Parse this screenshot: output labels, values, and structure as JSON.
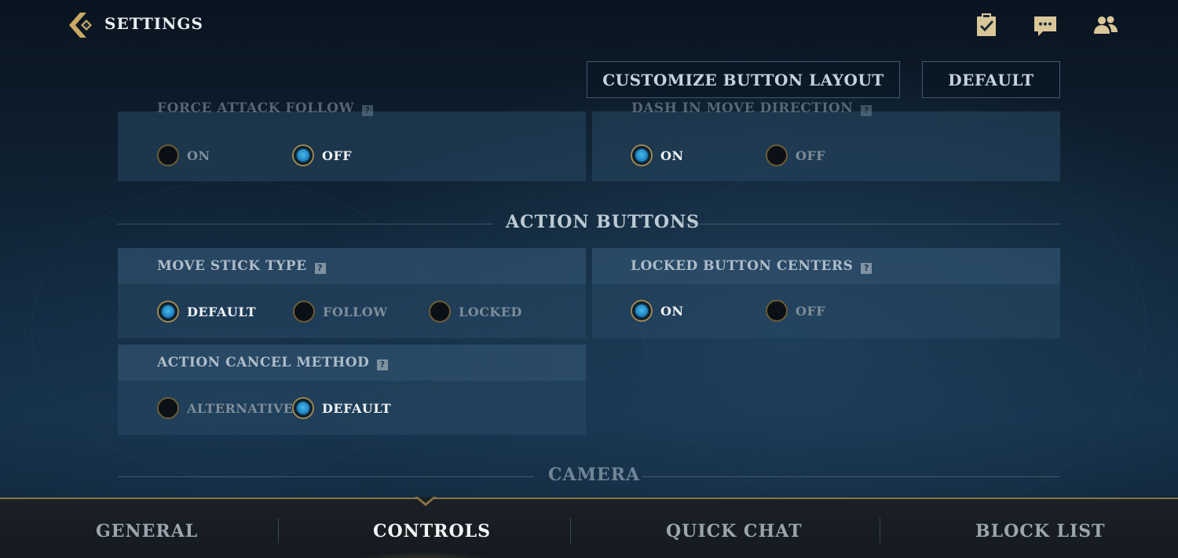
{
  "header": {
    "title": "SETTINGS",
    "icons": [
      "checklist-icon",
      "chat-icon",
      "friends-icon"
    ]
  },
  "actions": {
    "customize_label": "CUSTOMIZE BUTTON LAYOUT",
    "default_label": "DEFAULT"
  },
  "panels": {
    "force_attack_follow": {
      "title": "FORCE ATTACK FOLLOW",
      "options": [
        {
          "label": "ON",
          "selected": false
        },
        {
          "label": "OFF",
          "selected": true
        }
      ]
    },
    "dash_in_move_direction": {
      "title": "DASH IN MOVE DIRECTION",
      "options": [
        {
          "label": "ON",
          "selected": true
        },
        {
          "label": "OFF",
          "selected": false
        }
      ]
    },
    "move_stick_type": {
      "title": "MOVE STICK TYPE",
      "options": [
        {
          "label": "DEFAULT",
          "selected": true
        },
        {
          "label": "FOLLOW",
          "selected": false
        },
        {
          "label": "LOCKED",
          "selected": false
        }
      ]
    },
    "locked_button_centers": {
      "title": "LOCKED BUTTON CENTERS",
      "options": [
        {
          "label": "ON",
          "selected": true
        },
        {
          "label": "OFF",
          "selected": false
        }
      ]
    },
    "action_cancel_method": {
      "title": "ACTION CANCEL METHOD",
      "options": [
        {
          "label": "ALTERNATIVE",
          "selected": false
        },
        {
          "label": "DEFAULT",
          "selected": true
        }
      ]
    }
  },
  "sections": {
    "action_buttons": "ACTION BUTTONS",
    "camera": "CAMERA"
  },
  "help_glyph": "?",
  "tabs": [
    {
      "label": "GENERAL",
      "active": false
    },
    {
      "label": "CONTROLS",
      "active": true
    },
    {
      "label": "QUICK CHAT",
      "active": false
    },
    {
      "label": "BLOCK LIST",
      "active": false
    }
  ],
  "colors": {
    "gold_accent": "#a08752",
    "radio_selected": "#1f86c4",
    "panel_bg": "#28486a"
  }
}
